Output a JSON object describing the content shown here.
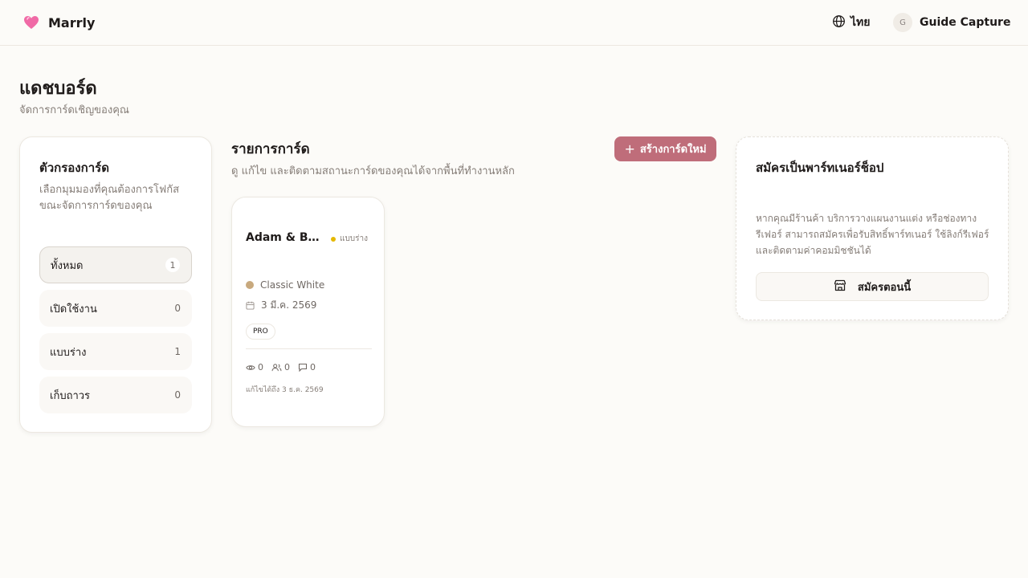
{
  "header": {
    "brand": "Marrly",
    "language": "ไทย",
    "user_initial": "G",
    "user_name": "Guide Capture"
  },
  "page": {
    "title": "แดชบอร์ด",
    "subtitle": "จัดการการ์ดเชิญของคุณ"
  },
  "filters": {
    "title": "ตัวกรองการ์ด",
    "description": "เลือกมุมมองที่คุณต้องการโฟกัสขณะจัดการการ์ดของคุณ",
    "items": [
      {
        "label": "ทั้งหมด",
        "count": "1",
        "active": true
      },
      {
        "label": "เปิดใช้งาน",
        "count": "0",
        "active": false
      },
      {
        "label": "แบบร่าง",
        "count": "1",
        "active": false
      },
      {
        "label": "เก็บถาวร",
        "count": "0",
        "active": false
      }
    ]
  },
  "cards_section": {
    "title": "รายการการ์ด",
    "description": "ดู แก้ไข และติดตามสถานะการ์ดของคุณได้จากพื้นที่ทำงานหลัก",
    "create_label": "สร้างการ์ดใหม่"
  },
  "cards": [
    {
      "name": "Adam & Bel...",
      "status": "แบบร่าง",
      "theme": "Classic White",
      "date": "3 มี.ค. 2569",
      "badge": "PRO",
      "views": "0",
      "guests": "0",
      "comments": "0",
      "edited": "แก้ไขได้ถึง 3 ธ.ค. 2569"
    }
  ],
  "partner": {
    "title": "สมัครเป็นพาร์ทเนอร์ช็อป",
    "description": "หากคุณมีร้านค้า บริการวางแผนงานแต่ง หรือช่องทางรีเฟอร์ สามารถสมัครเพื่อรับสิทธิ์พาร์ทเนอร์ ใช้ลิงก์รีเฟอร์ และติดตามค่าคอมมิชชันได้",
    "button_label": "สมัครตอนนี้"
  },
  "colors": {
    "accent": "#bf6d7a",
    "draft_status": "#e5b800",
    "theme_swatch": "#c8a97e",
    "brand_heart": "#f06aa6"
  }
}
